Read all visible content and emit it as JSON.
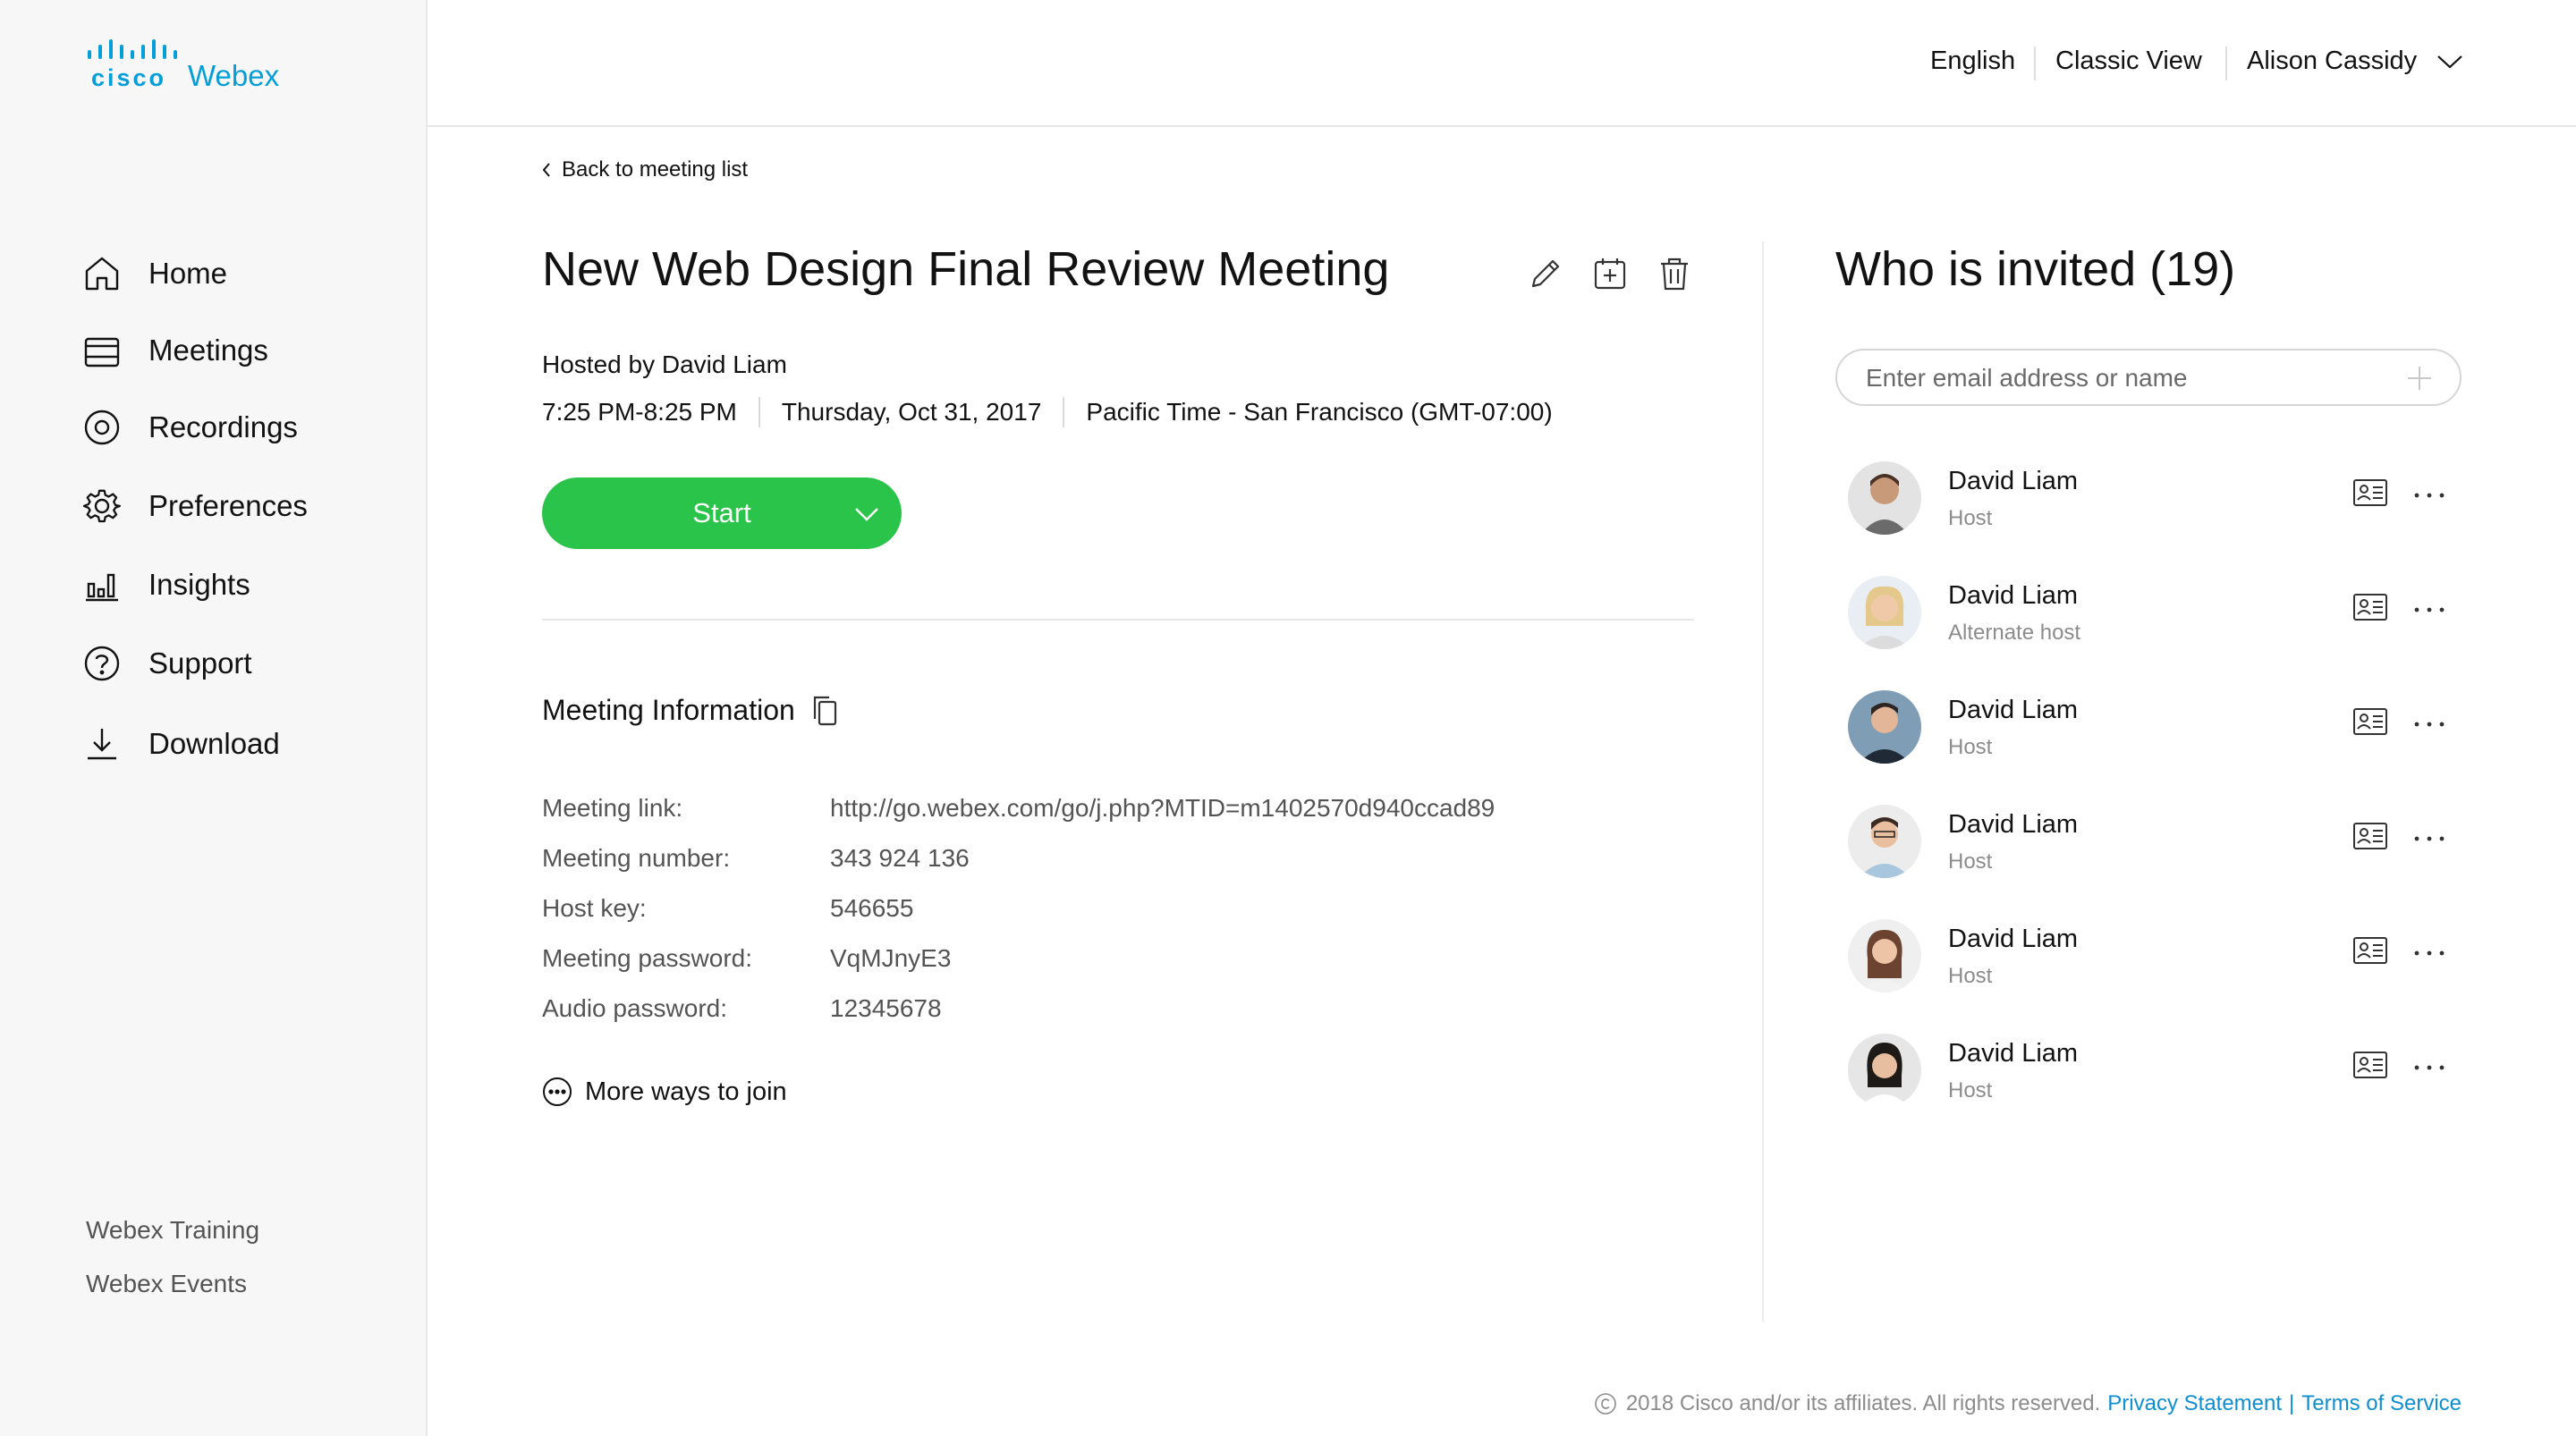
{
  "brand": {
    "cisco": "cisco",
    "product": "Webex",
    "cisco_color": "#049fd9"
  },
  "sidebar": {
    "items": [
      {
        "label": "Home",
        "icon": "home-icon"
      },
      {
        "label": "Meetings",
        "icon": "calendar-icon"
      },
      {
        "label": "Recordings",
        "icon": "record-icon"
      },
      {
        "label": "Preferences",
        "icon": "gear-icon"
      },
      {
        "label": "Insights",
        "icon": "bar-chart-icon"
      },
      {
        "label": "Support",
        "icon": "help-icon"
      },
      {
        "label": "Download",
        "icon": "download-icon"
      }
    ],
    "bottom_links": [
      "Webex Training",
      "Webex Events"
    ]
  },
  "header": {
    "language": "English",
    "classic_view": "Classic View",
    "user_name": "Alison Cassidy"
  },
  "main": {
    "back_link": "Back to meeting list",
    "title": "New Web Design Final Review Meeting",
    "hosted_by": "Hosted by David Liam",
    "time": "7:25 PM-8:25 PM",
    "date": "Thursday, Oct 31, 2017",
    "timezone": "Pacific Time - San Francisco (GMT-07:00)",
    "start_label": "Start",
    "start_color": "#2bc44a",
    "info_title": "Meeting Information",
    "info": [
      {
        "label": "Meeting link:",
        "value": "http://go.webex.com/go/j.php?MTID=m1402570d940ccad89"
      },
      {
        "label": "Meeting number:",
        "value": "343 924 136"
      },
      {
        "label": "Host key:",
        "value": "546655"
      },
      {
        "label": "Meeting password:",
        "value": "VqMJnyE3"
      },
      {
        "label": "Audio password:",
        "value": "12345678"
      }
    ],
    "more_ways": "More ways to join"
  },
  "invited": {
    "title": "Who is invited (19)",
    "search_placeholder": "Enter email address or name",
    "people": [
      {
        "name": "David Liam",
        "role": "Host"
      },
      {
        "name": "David Liam",
        "role": "Alternate host"
      },
      {
        "name": "David Liam",
        "role": "Host"
      },
      {
        "name": "David Liam",
        "role": "Host"
      },
      {
        "name": "David Liam",
        "role": "Host"
      },
      {
        "name": "David Liam",
        "role": "Host"
      }
    ]
  },
  "footer": {
    "copyright": "2018 Cisco and/or its affiliates. All rights reserved.",
    "privacy": "Privacy Statement",
    "separator": "|",
    "terms": "Terms of Service",
    "link_color": "#0f8fd0"
  }
}
